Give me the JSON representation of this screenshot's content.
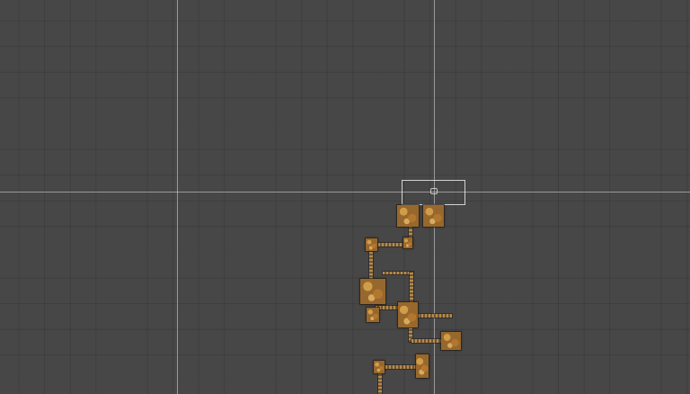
{
  "scene": {
    "background_color": "#474747",
    "grid_color": "#3f3f3f",
    "axis_color": "#d8d8d8",
    "room_color": "#c08a3c"
  },
  "icons": {
    "camera": "camera-icon"
  }
}
